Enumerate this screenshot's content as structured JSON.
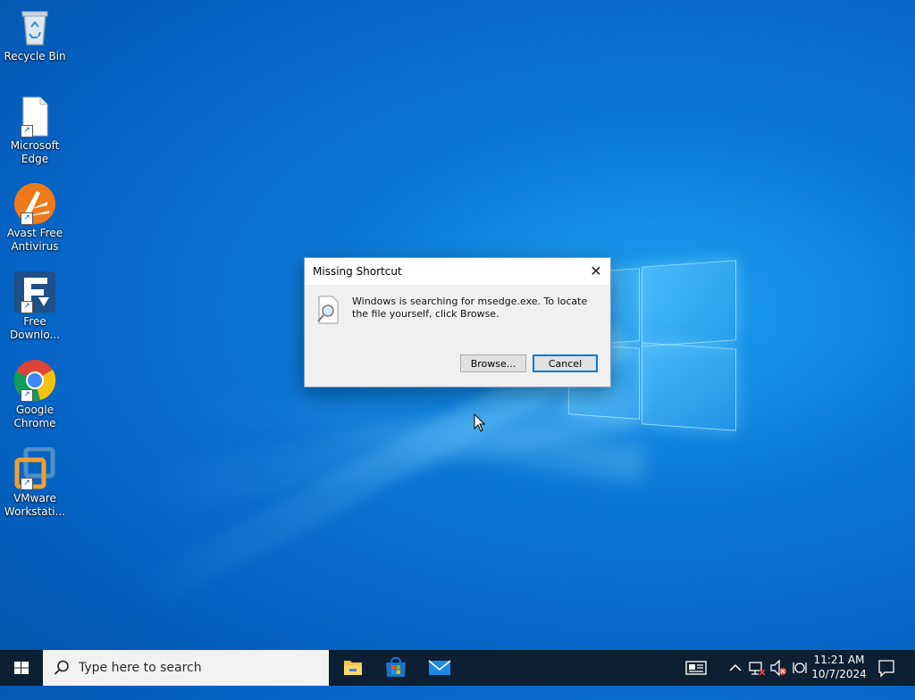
{
  "desktop": {
    "icons": [
      {
        "label": "Recycle Bin"
      },
      {
        "label": "Microsoft Edge"
      },
      {
        "label": "Avast Free Antivirus"
      },
      {
        "label": "Free Downlo..."
      },
      {
        "label": "Google Chrome"
      },
      {
        "label": "VMware Workstati..."
      }
    ]
  },
  "dialog": {
    "title": "Missing Shortcut",
    "message": "Windows is searching for msedge.exe. To locate the file yourself, click Browse.",
    "browse_label": "Browse...",
    "cancel_label": "Cancel"
  },
  "taskbar": {
    "search_placeholder": "Type here to search",
    "apps": [
      {
        "icon": "file-explorer-icon"
      },
      {
        "icon": "microsoft-store-icon"
      },
      {
        "icon": "mail-icon"
      }
    ],
    "clock": {
      "time": "11:21 AM",
      "date": "10/7/2024"
    }
  }
}
